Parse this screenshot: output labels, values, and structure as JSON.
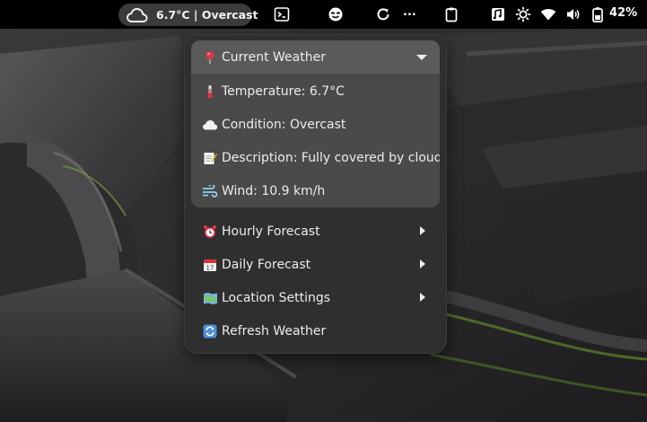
{
  "topbar": {
    "weather_indicator": "6.7°C | Overcast",
    "indicator_icon": "cloud-icon",
    "ellipsis": "...",
    "battery_percent": "42%",
    "icons": [
      "terminal-icon",
      "emoji-icon",
      "refresh-icon",
      "clipboard-icon",
      "note-icon",
      "brightness-icon",
      "wifi-icon",
      "volume-icon",
      "battery-icon"
    ]
  },
  "menu": {
    "current_weather": {
      "title": "Current Weather",
      "icon": "pin-icon",
      "items": [
        {
          "icon": "thermometer-icon",
          "label": "Temperature: 6.7°C"
        },
        {
          "icon": "cloud-icon",
          "label": "Condition: Overcast"
        },
        {
          "icon": "memo-icon",
          "label": "Description: Fully covered by clouds"
        },
        {
          "icon": "wind-icon",
          "label": "Wind: 10.9 km/h"
        }
      ]
    },
    "items": [
      {
        "icon": "alarm-clock-icon",
        "label": "Hourly Forecast"
      },
      {
        "icon": "calendar-icon",
        "label": "Daily Forecast"
      },
      {
        "icon": "map-icon",
        "label": "Location Settings"
      },
      {
        "icon": "refresh-icon",
        "label": "Refresh Weather"
      }
    ]
  }
}
